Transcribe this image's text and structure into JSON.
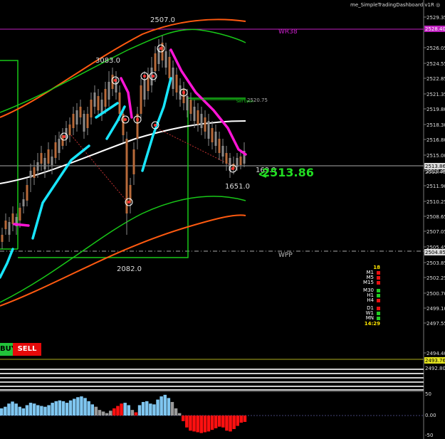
{
  "window": {
    "indicator_title": "me_SimpleTradingDashboard v1R ◎"
  },
  "price_axis": {
    "ticks": [
      "2529.35",
      "2526.05",
      "2524.55",
      "2522.85",
      "2521.35",
      "2519.80",
      "2518.30",
      "2516.80",
      "2515.00",
      "2513.40",
      "2511.90",
      "2510.25",
      "2508.65",
      "2507.05",
      "2505.45",
      "2503.85",
      "2502.25",
      "2500.70",
      "2499.10",
      "2497.55",
      "2494.40",
      "2492.80"
    ],
    "highlight_wr38": "2528.40",
    "highlight_bid": "2513.86",
    "highlight_current": "2513.46",
    "highlight_wpp": "2504.85",
    "highlight_bottom": "2493.76",
    "current_marker": "2513.86"
  },
  "lines": {
    "wr38_label": "WR38",
    "wpp_label": "WPP",
    "sell_open_label": "Sell Open",
    "sell_open_price": "2520.75"
  },
  "annotations": {
    "high_count": "2507.0",
    "left_count": "3083.0",
    "low_count": "2082.0",
    "right_count": "1651.0",
    "near_count": "169.0"
  },
  "big_price": "2513.86",
  "buttons": {
    "buy_label": "BUY",
    "sell_label": "SELL"
  },
  "dashboard": {
    "top_value": "18",
    "rows": [
      {
        "label": "M1",
        "color": "#e81010"
      },
      {
        "label": "M5",
        "color": "#e81010"
      },
      {
        "label": "M15",
        "color": "#e81010"
      },
      {
        "gap": true
      },
      {
        "label": "M30",
        "color": "#22cc22"
      },
      {
        "label": "H1",
        "color": "#22cc22"
      },
      {
        "label": "H4",
        "color": "#e81010"
      },
      {
        "gap": true
      },
      {
        "label": "D1",
        "color": "#e81010"
      },
      {
        "label": "W1",
        "color": "#22cc22"
      },
      {
        "label": "MN",
        "color": "#22cc22"
      }
    ],
    "bottom_value": "14:29"
  },
  "oscillator": {
    "upper_label": "50",
    "zero_label": "0.00",
    "lower_label": "-50",
    "top_label": "50"
  },
  "colors": {
    "up_bar": "#7fc6f0",
    "neutral_bar": "#9a9a9a",
    "down_bar": "#ff1010",
    "cyan": "#18e6ff",
    "magenta": "#ff14d6",
    "green_band": "#18c818",
    "orange_band": "#ff5a10",
    "white_ma": "#ffffff"
  },
  "chart_data": {
    "type": "histogram",
    "title": "",
    "ylim": [
      -50,
      50
    ],
    "values": [
      18,
      22,
      30,
      35,
      30,
      22,
      18,
      26,
      32,
      30,
      26,
      24,
      22,
      26,
      32,
      36,
      38,
      36,
      32,
      38,
      42,
      46,
      48,
      44,
      36,
      28,
      22,
      14,
      10,
      6,
      12,
      18,
      24,
      30,
      32,
      26,
      14,
      8,
      26,
      34,
      36,
      30,
      28,
      40,
      48,
      52,
      44,
      34,
      18,
      6,
      -14,
      -30,
      -38,
      -40,
      -42,
      -44,
      -42,
      -40,
      -36,
      -32,
      -28,
      -30,
      -38,
      -40,
      -34,
      -26,
      -18,
      -16
    ],
    "colors": [
      "u",
      "u",
      "u",
      "u",
      "u",
      "u",
      "u",
      "u",
      "u",
      "u",
      "u",
      "u",
      "u",
      "u",
      "u",
      "u",
      "u",
      "u",
      "u",
      "u",
      "u",
      "u",
      "u",
      "u",
      "u",
      "u",
      "n",
      "n",
      "n",
      "n",
      "n",
      "d",
      "d",
      "d",
      "u",
      "u",
      "n",
      "d",
      "u",
      "u",
      "u",
      "u",
      "u",
      "u",
      "u",
      "u",
      "u",
      "n",
      "n",
      "n",
      "d",
      "d",
      "d",
      "d",
      "d",
      "d",
      "d",
      "d",
      "d",
      "d",
      "d",
      "d",
      "d",
      "d",
      "d",
      "d",
      "d",
      "d"
    ]
  }
}
